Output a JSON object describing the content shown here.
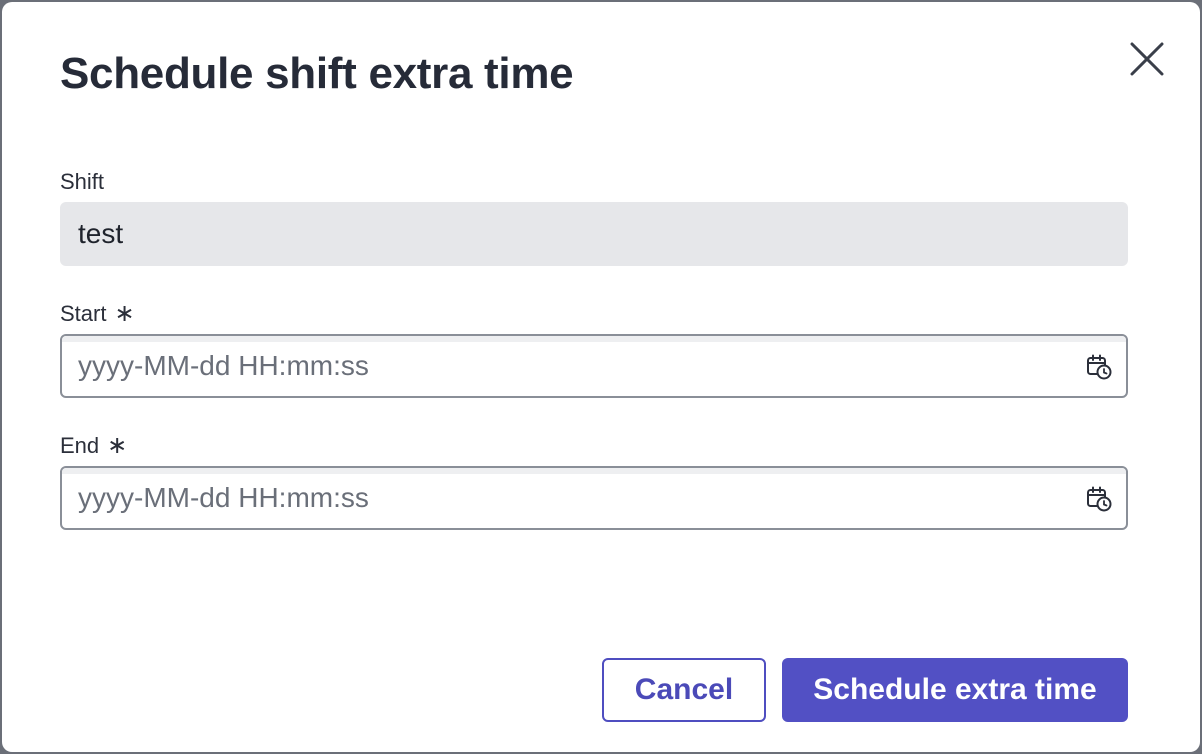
{
  "dialog": {
    "title": "Schedule shift extra time",
    "close_icon": "close-icon"
  },
  "fields": {
    "shift": {
      "label": "Shift",
      "value": "test"
    },
    "start": {
      "label": "Start",
      "required_marker": "∗",
      "value": "",
      "placeholder": "yyyy-MM-dd HH:mm:ss",
      "icon": "calendar-clock-icon"
    },
    "end": {
      "label": "End",
      "required_marker": "∗",
      "value": "",
      "placeholder": "yyyy-MM-dd HH:mm:ss",
      "icon": "calendar-clock-icon"
    }
  },
  "actions": {
    "cancel_label": "Cancel",
    "submit_label": "Schedule extra time"
  },
  "colors": {
    "primary": "#5250c4",
    "title_text": "#262b38",
    "readonly_bg": "#e6e7ea",
    "input_border": "#8a8f98"
  }
}
